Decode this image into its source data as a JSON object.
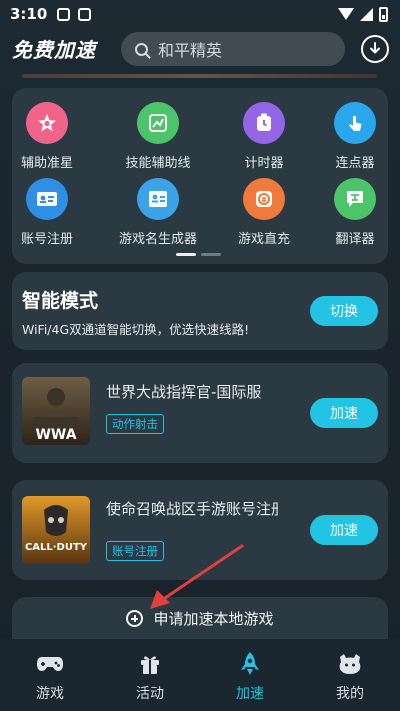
{
  "status_bar": {
    "time": "3:10"
  },
  "header": {
    "app_title": "免费加速",
    "search_placeholder": "和平精英"
  },
  "tools": [
    {
      "label": "辅助准星",
      "icon": "crosshair-star-icon",
      "color": "#f0648c"
    },
    {
      "label": "技能辅助线",
      "icon": "skill-line-icon",
      "color": "#4cc46a"
    },
    {
      "label": "计时器",
      "icon": "timer-icon",
      "color": "#9266e6"
    },
    {
      "label": "连点器",
      "icon": "auto-clicker-icon",
      "color": "#2aa7ec"
    },
    {
      "label": "账号注册",
      "icon": "account-card-icon",
      "color": "#2f8fe4"
    },
    {
      "label": "游戏名生成器",
      "icon": "name-generator-icon",
      "color": "#3ba3e8"
    },
    {
      "label": "游戏直充",
      "icon": "recharge-icon",
      "color": "#f07a3c"
    },
    {
      "label": "翻译器",
      "icon": "translate-icon",
      "color": "#4cc46a"
    }
  ],
  "smart_mode": {
    "title": "智能模式",
    "description": "WiFi/4G双通道智能切换，优选快速线路!",
    "button": "切换"
  },
  "games": [
    {
      "name": "世界大战指挥官-国际服",
      "tag": "动作射击",
      "button": "加速"
    },
    {
      "name": "使命召唤战区手游账号注册-国际服",
      "tag": "账号注册",
      "button": "加速"
    }
  ],
  "add_local": {
    "label": "申请加速本地游戏"
  },
  "tabbar": [
    {
      "label": "游戏",
      "icon": "gamepad-icon"
    },
    {
      "label": "活动",
      "icon": "gift-icon"
    },
    {
      "label": "加速",
      "icon": "rocket-icon"
    },
    {
      "label": "我的",
      "icon": "profile-face-icon"
    }
  ],
  "colors": {
    "accent": "#22c3e3",
    "card": "#2b3943",
    "background": "#1d2a33",
    "arrow": "#e04040"
  }
}
